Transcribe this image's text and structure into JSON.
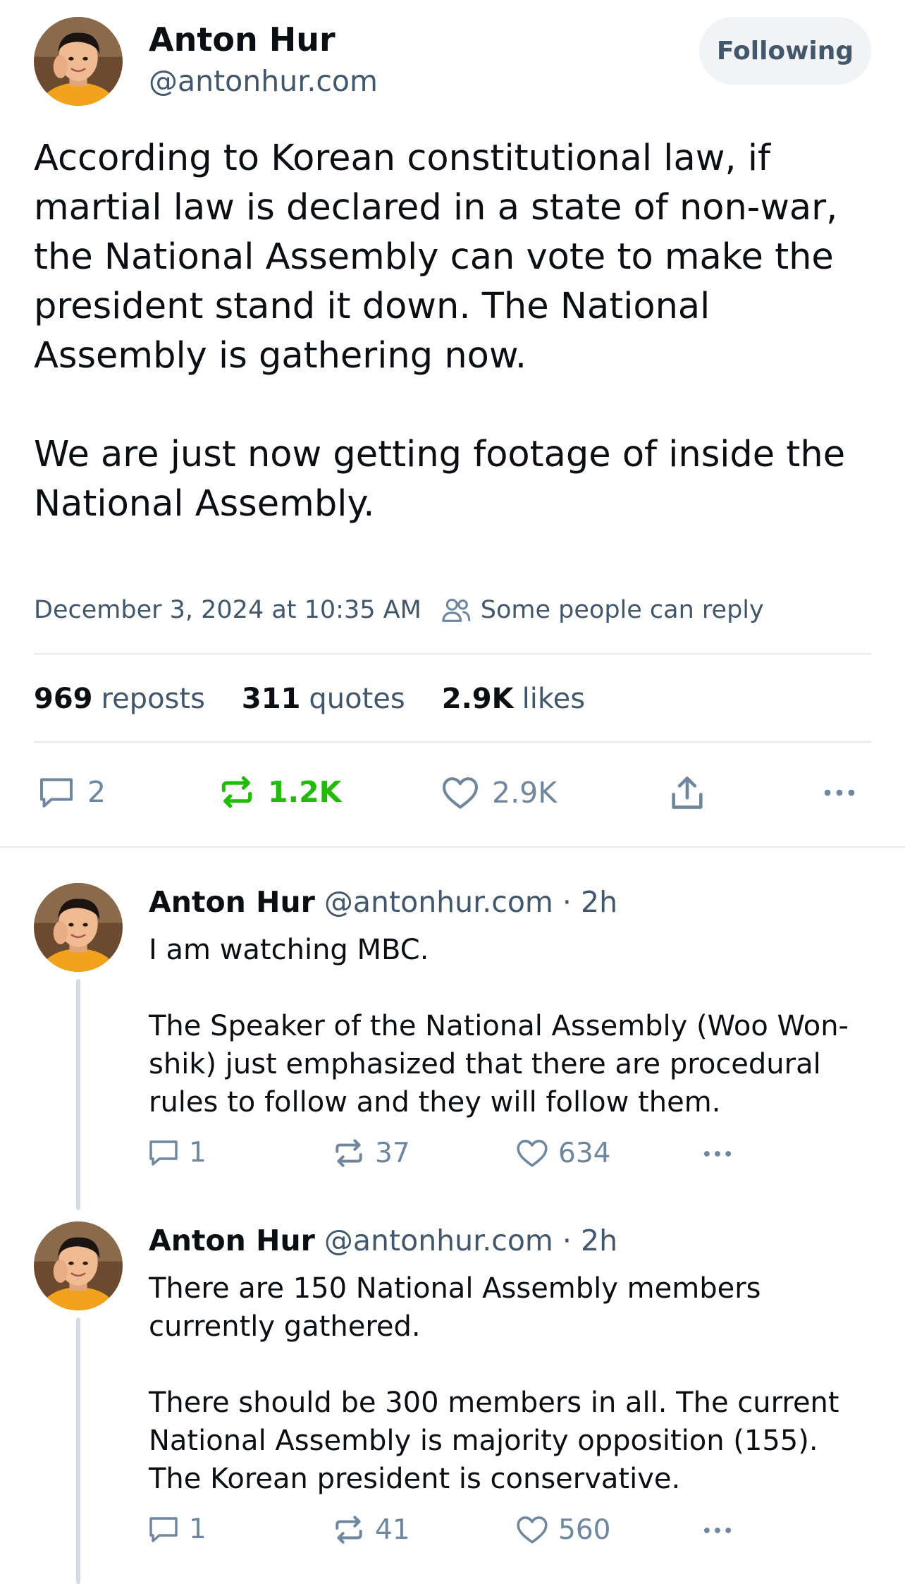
{
  "post": {
    "author_name": "Anton Hur",
    "author_handle": "@antonhur.com",
    "follow_label": "Following",
    "paragraphs": [
      "According to Korean constitutional law, if martial law is declared in a state of non-war, the National Assembly can vote to make the president stand it down. The National Assembly is gathering now.",
      "We are just now getting footage of inside the National Assembly."
    ],
    "timestamp": "December 3, 2024 at 10:35 AM",
    "reply_setting": "Some people can reply",
    "stats": {
      "reposts_count": "969",
      "reposts_label": "reposts",
      "quotes_count": "311",
      "quotes_label": "quotes",
      "likes_count": "2.9K",
      "likes_label": "likes"
    },
    "actions": {
      "reply_count": "2",
      "repost_count": "1.2K",
      "like_count": "2.9K"
    },
    "repost_active_color": "#20bc07"
  },
  "replies": [
    {
      "author_name": "Anton Hur",
      "author_handle": "@antonhur.com",
      "separator": "·",
      "time": "2h",
      "paragraphs": [
        "I am watching MBC.",
        "The Speaker of the National Assembly (Woo Won-shik) just emphasized that there are procedural rules to follow and they will follow them."
      ],
      "reply_count": "1",
      "repost_count": "37",
      "like_count": "634"
    },
    {
      "author_name": "Anton Hur",
      "author_handle": "@antonhur.com",
      "separator": "·",
      "time": "2h",
      "paragraphs": [
        "There are 150 National Assembly members currently gathered.",
        "There should be 300 members in all. The current National Assembly is majority opposition (155). The Korean president is conservative."
      ],
      "reply_count": "1",
      "repost_count": "41",
      "like_count": "560"
    }
  ],
  "icons": {
    "reply": "speech-bubble-icon",
    "repost": "repost-arrows-icon",
    "like": "heart-icon",
    "share": "share-upload-icon",
    "more": "ellipsis-icon",
    "reply_setting": "people-icon"
  }
}
